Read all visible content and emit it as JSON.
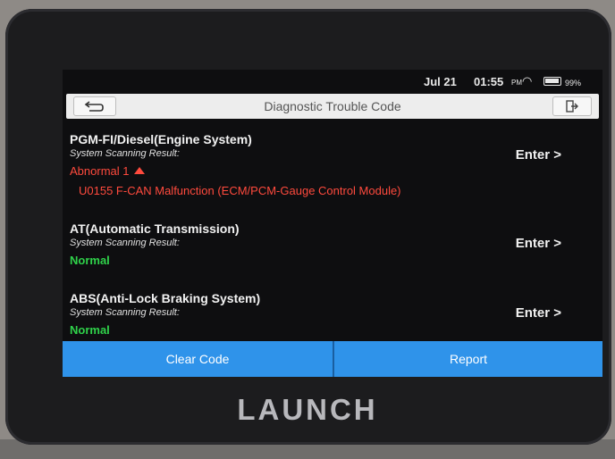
{
  "status_bar": {
    "date": "Jul 21",
    "time": "01:55",
    "ampm": "PM",
    "battery": "99%"
  },
  "header": {
    "title": "Diagnostic Trouble Code"
  },
  "systems": [
    {
      "name": "PGM-FI/Diesel(Engine System)",
      "result_label": "System Scanning Result:",
      "status": "Abnormal 1",
      "dtc": "U0155 F-CAN Malfunction (ECM/PCM-Gauge Control Module)",
      "enter_label": "Enter >"
    },
    {
      "name": "AT(Automatic Transmission)",
      "result_label": "System Scanning Result:",
      "status": "Normal",
      "enter_label": "Enter >"
    },
    {
      "name": "ABS(Anti-Lock Braking System)",
      "result_label": "System Scanning Result:",
      "status": "Normal",
      "enter_label": "Enter >"
    }
  ],
  "actions": {
    "clear_code": "Clear Code",
    "report": "Report"
  },
  "brand": "LAUNCH",
  "colors": {
    "accent": "#2f93ea",
    "abnormal": "#ff4a3d",
    "normal": "#2fd24a"
  }
}
